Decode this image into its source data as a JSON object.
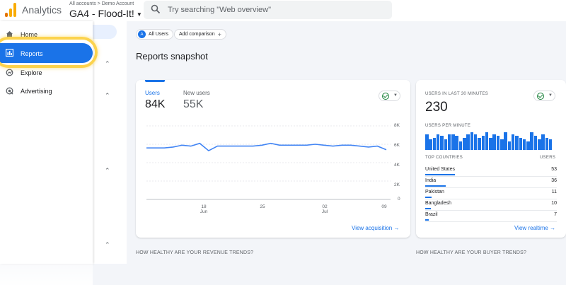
{
  "header": {
    "app_title": "Analytics",
    "breadcrumb": "All accounts  >  Demo Account",
    "property_name": "GA4 - Flood-It!",
    "search_placeholder": "Try searching \"Web overview\""
  },
  "sidebar": {
    "items": [
      {
        "label": "Home",
        "icon": "home-icon"
      },
      {
        "label": "Reports",
        "icon": "reports-icon",
        "selected": true
      },
      {
        "label": "Explore",
        "icon": "explore-icon"
      },
      {
        "label": "Advertising",
        "icon": "advertising-icon"
      }
    ]
  },
  "toolbar": {
    "all_users_badge": "A",
    "all_users": "All Users",
    "add_comparison": "Add comparison"
  },
  "page_title": "Reports snapshot",
  "overview_card": {
    "metrics": [
      {
        "label": "Users",
        "value": "84K",
        "active": true
      },
      {
        "label": "New users",
        "value": "55K",
        "active": false
      }
    ],
    "link": "View acquisition"
  },
  "chart_data": {
    "type": "line",
    "x": [
      "",
      "",
      "",
      "",
      "",
      "",
      "",
      "",
      "",
      "",
      "",
      "",
      "",
      "",
      "",
      "",
      "",
      "",
      "",
      "",
      "",
      "",
      "",
      "",
      "",
      "",
      "",
      ""
    ],
    "series": [
      {
        "values": [
          5.6,
          5.6,
          5.6,
          5.7,
          5.9,
          5.8,
          6.1,
          5.3,
          5.8,
          5.8,
          5.8,
          5.8,
          5.8,
          5.9,
          6.1,
          5.9,
          5.9,
          5.9,
          5.9,
          6.0,
          5.9,
          5.8,
          5.9,
          5.9,
          5.8,
          5.7,
          5.8,
          5.4
        ]
      }
    ],
    "y_ticks": [
      "8K",
      "6K",
      "4K",
      "2K",
      "0"
    ],
    "ylim": [
      0,
      8
    ],
    "x_ticks": [
      {
        "label": "18",
        "sub": "Jun"
      },
      {
        "label": "25",
        "sub": ""
      },
      {
        "label": "02",
        "sub": "Jul"
      },
      {
        "label": "09",
        "sub": ""
      }
    ],
    "color": "#4285f4"
  },
  "realtime_card": {
    "title": "USERS IN LAST 30 MINUTES",
    "value": "230",
    "per_minute_label": "USERS PER MINUTE",
    "per_minute": [
      9,
      6,
      7,
      9,
      8,
      6,
      9,
      9,
      8,
      5,
      7,
      9,
      10,
      9,
      7,
      8,
      10,
      7,
      9,
      8,
      6,
      10,
      5,
      9,
      8,
      7,
      6,
      5,
      10,
      8,
      6,
      9,
      7,
      6
    ],
    "countries_header": "TOP COUNTRIES",
    "users_header": "USERS",
    "countries": [
      {
        "name": "United States",
        "users": "53",
        "share": 1.0
      },
      {
        "name": "India",
        "users": "36",
        "share": 0.68
      },
      {
        "name": "Pakistan",
        "users": "11",
        "share": 0.21
      },
      {
        "name": "Bangladesh",
        "users": "10",
        "share": 0.19
      },
      {
        "name": "Brazil",
        "users": "7",
        "share": 0.13
      }
    ],
    "link": "View realtime"
  },
  "sections": {
    "revenue_question": "HOW HEALTHY ARE YOUR REVENUE TRENDS?",
    "buyer_question": "HOW HEALTHY ARE YOUR BUYER TRENDS?"
  },
  "colors": {
    "accent": "#1a73e8",
    "highlight": "#fcd34d",
    "good": "#188038"
  }
}
